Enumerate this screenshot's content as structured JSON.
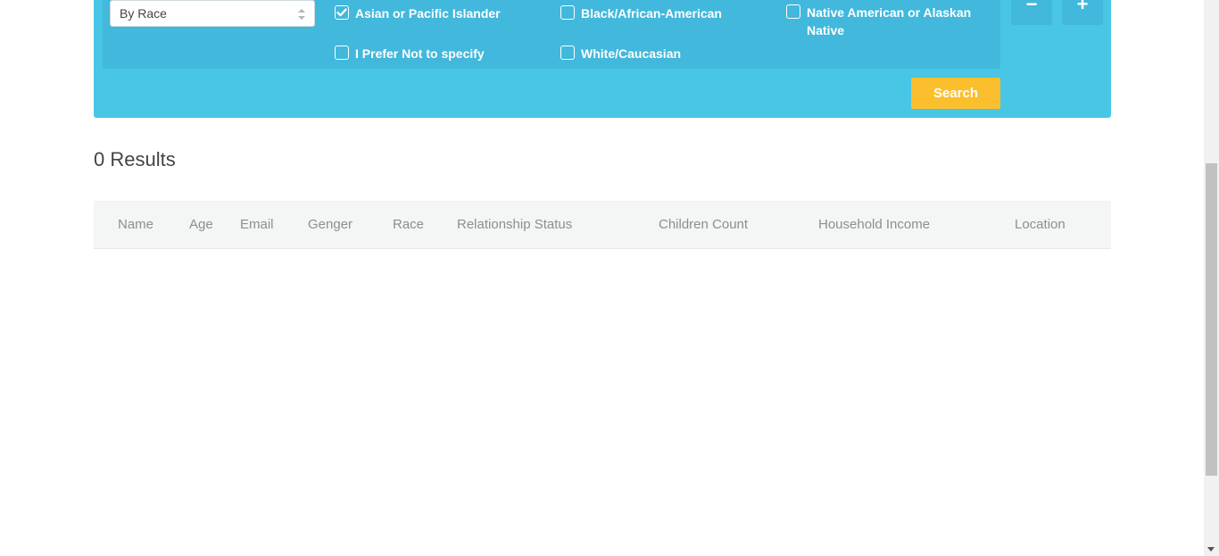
{
  "filter": {
    "select_value": "By Race",
    "checkboxes": [
      {
        "label": "Asian or Pacific Islander",
        "checked": true
      },
      {
        "label": "Black/African-American",
        "checked": false
      },
      {
        "label": "Native American or Alaskan Native",
        "checked": false
      },
      {
        "label": "I Prefer Not to specify",
        "checked": false
      },
      {
        "label": "White/Caucasian",
        "checked": false
      }
    ],
    "remove_label": "−",
    "add_label": "+",
    "search_label": "Search"
  },
  "results": {
    "count_text": "0 Results"
  },
  "table": {
    "columns": [
      "Name",
      "Age",
      "Email",
      "Genger",
      "Race",
      "Relationship Status",
      "Children Count",
      "Household Income",
      "Location"
    ]
  },
  "colors": {
    "panel": "#49c5e6",
    "panel_inner": "#41b8dc",
    "search_button": "#fbbf2d"
  }
}
